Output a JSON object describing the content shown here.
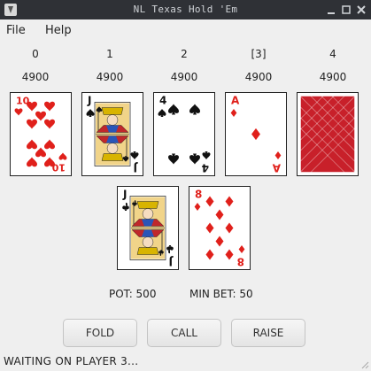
{
  "window": {
    "title": "NL Texas Hold 'Em"
  },
  "menu": {
    "file": "File",
    "help": "Help"
  },
  "players": [
    {
      "label": "0",
      "chips": "4900"
    },
    {
      "label": "1",
      "chips": "4900"
    },
    {
      "label": "2",
      "chips": "4900"
    },
    {
      "label": "[3]",
      "chips": "4900"
    },
    {
      "label": "4",
      "chips": "4900"
    }
  ],
  "community_cards": [
    {
      "rank": "10",
      "suit": "hearts",
      "color": "#e0201b"
    },
    {
      "rank": "J",
      "suit": "spades",
      "color": "#111111"
    },
    {
      "rank": "4",
      "suit": "spades",
      "color": "#111111"
    },
    {
      "rank": "A",
      "suit": "diamonds",
      "color": "#e0201b"
    },
    {
      "rank": "",
      "suit": "card-back",
      "color": "#c8202a"
    }
  ],
  "hole_cards": [
    {
      "rank": "J",
      "suit": "clubs",
      "color": "#111111"
    },
    {
      "rank": "8",
      "suit": "diamonds",
      "color": "#e0201b"
    }
  ],
  "pot": {
    "text": "POT: 500"
  },
  "min_bet": {
    "text": "MIN BET: 50"
  },
  "buttons": {
    "fold": "FOLD",
    "call": "CALL",
    "raise": "RAISE"
  },
  "status": "WAITING ON PLAYER 3..."
}
